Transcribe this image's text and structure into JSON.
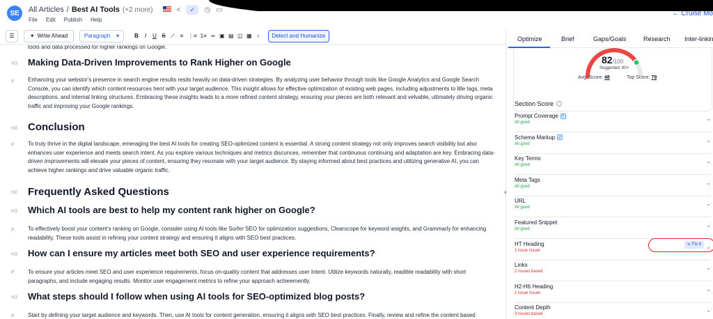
{
  "header": {
    "breadcrumb_parent": "All Articles",
    "breadcrumb_sep": "/",
    "breadcrumb_current": "Best AI Tools",
    "breadcrumb_more": "(+2 more)",
    "menu": [
      "File",
      "Edit",
      "Publish",
      "Help"
    ],
    "cruise_label": "← Cruise Mo"
  },
  "toolbar": {
    "write_ahead": "Write Ahead",
    "paragraph": "Paragraph",
    "bold": "B",
    "italic": "I",
    "underline": "U",
    "strike": "S",
    "detect": "Detect and Humanize"
  },
  "editor": {
    "top_cut": "tools and data processed for higher rankings on Google.",
    "blocks": [
      {
        "tag": "H3",
        "text": "Making Data-Driven Improvements to Rank Higher on Google"
      },
      {
        "tag": "P",
        "text": "Enhancing your webstor's presence in search engine results resits heavily on data-driven strategies. By analyzing user behavior through tools like Google Analytics and Google Search Console, you can identify which content resources hent with your target audience. This insight allows for effective optimization of existing web pages, including adjustments to lille tags, meta descriptions, and internal linking structures. Embracing these insights leads to a more refined content strategy, ensuring your pieces are both relevant and velvable, ultimately driving organic traffic and improving your Google rankings."
      },
      {
        "tag": "H3",
        "text": "Conclusion"
      },
      {
        "tag": "P",
        "text": "To truly thrive in the digital landscape, emeraging the best AI tools for creating SEO-optimized content is essential. A strong content strategy not only improves search visibility but also enhances user experience and meets search intent. As you explore various techniques and metrics discunces, remember that continuous continuing and adaptation are key. Embracing data-driven improvements will elevate your pieces of content, ensuring they resonate with your target audience. By staying informed about best practices and utilizing generative AI, you can achieve higher rankings and drive valuable organic traffic."
      },
      {
        "tag": "H2",
        "text": "Frequently Asked Questions"
      },
      {
        "tag": "H3",
        "text": "Which AI tools are best to help my content rank higher on Google?"
      },
      {
        "tag": "P",
        "text": "To effectively boost your content's ranking on Google, consider using AI tools like Surfer SEO for optimization suggestions, Clearscope for keyword wsights, and Grammarly for enhancing readability. These tools assist in refining your content strategy and ensuring it aligns with SEO best practices."
      },
      {
        "tag": "H3",
        "text": "How can I ensure my articles meet both SEO and user experience requirements?"
      },
      {
        "tag": "P",
        "text": "To ensure your articles meet SEO and user experience requirements, focus on-quality content that addresses user Intent. Utilize keywords naturally, readible readability with short paragraphs, and include engaging results. Monitor user engagement metrics to refine your approach achieemently."
      },
      {
        "tag": "H3",
        "text": "What steps should I follow when using AI tools for SEO-optimized blog posts?"
      },
      {
        "tag": "P",
        "text": "Start by defining your target audience and keywords. Then, use AI tools for content generation, ensuring it aligns with SEO best practices. Finally, review and refine the content based"
      }
    ]
  },
  "panel": {
    "tabs": [
      "Optimize",
      "Brief",
      "Gaps/Goals",
      "Research",
      "Inter-linking"
    ],
    "score": {
      "value": "82",
      "max": "/100",
      "suggested": "Suggested: 80+",
      "avg_label": "Avg. Score:",
      "avg_value": "48",
      "top_label": "Top Score:",
      "top_value": "79",
      "fraction": 0.82
    },
    "section_score_title": "Section Score",
    "rows": [
      {
        "name": "Prompt Coverage",
        "status": "All good",
        "ok": true,
        "check": true
      },
      {
        "name": "Schema Markup",
        "status": "All good",
        "ok": true,
        "check": true
      },
      {
        "name": "Key Terms",
        "status": "All good",
        "ok": true,
        "check": false
      },
      {
        "name": "Meta Tags",
        "status": "All good",
        "ok": true,
        "check": false
      },
      {
        "name": "URL",
        "status": "All good",
        "ok": true,
        "check": false
      },
      {
        "name": "Featured Snippet",
        "status": "All good",
        "ok": true,
        "check": false
      },
      {
        "name": "HT Heading",
        "status": "1 issue Issuet",
        "ok": false,
        "check": false,
        "fix": "Fix It"
      },
      {
        "name": "Links",
        "status": "2 Issues based",
        "ok": false,
        "check": false
      },
      {
        "name": "H2-H6 Heading",
        "status": "1 Issue Issuet",
        "ok": false,
        "check": false
      },
      {
        "name": "Content Depth",
        "status": "3 Issues based",
        "ok": false,
        "check": false
      }
    ]
  },
  "colors": {
    "accent": "#2563eb",
    "good": "#16a34a",
    "bad": "#dc2626",
    "gauge_red": "#ef4444",
    "gauge_orange": "#f97316",
    "gauge_green": "#22c55e"
  }
}
